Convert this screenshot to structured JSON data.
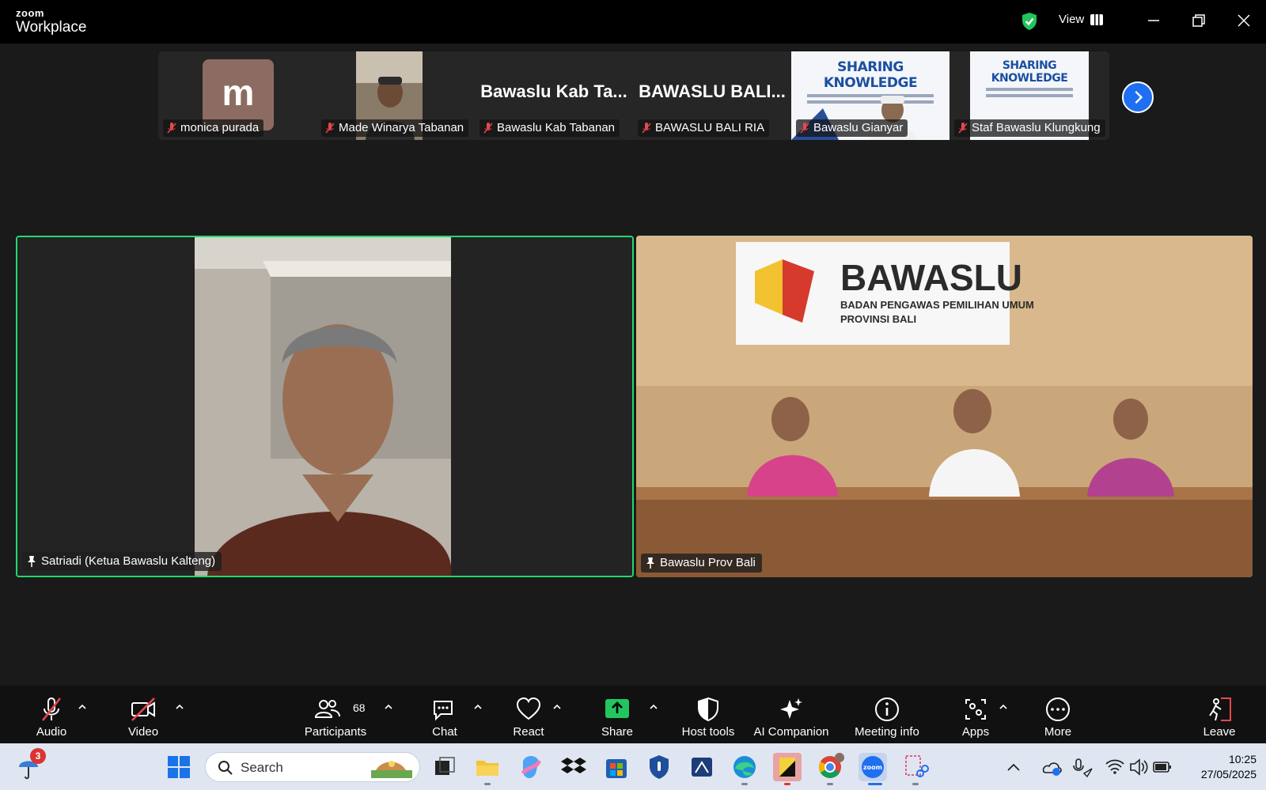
{
  "app": {
    "brand_top": "zoom",
    "brand_bottom": "Workplace",
    "view_label": "View"
  },
  "thumbnails": [
    {
      "name": "monica purada",
      "avatar_letter": "m"
    },
    {
      "name": "Made Winarya Tabanan"
    },
    {
      "name": "Bawaslu Kab Tabanan",
      "big_label": "Bawaslu Kab Ta..."
    },
    {
      "name": "BAWASLU BALI RIA",
      "big_label": "BAWASLU BALI..."
    },
    {
      "name": "Bawaslu Gianyar",
      "slide_title": "SHARING KNOWLEDGE"
    },
    {
      "name": "Staf Bawaslu Klungkung",
      "slide_title": "SHARING KNOWLEDGE"
    }
  ],
  "tiles": {
    "left": {
      "name": "Satriadi (Ketua Bawaslu Kalteng)"
    },
    "right": {
      "name": "Bawaslu Prov Bali",
      "banner_title": "BAWASLU",
      "banner_sub1": "BADAN PENGAWAS PEMILIHAN UMUM",
      "banner_sub2": "PROVINSI BALI"
    }
  },
  "toolbar": {
    "audio": "Audio",
    "video": "Video",
    "participants": "Participants",
    "participants_count": "68",
    "chat": "Chat",
    "react": "React",
    "share": "Share",
    "host_tools": "Host tools",
    "ai_companion": "AI Companion",
    "meeting_info": "Meeting info",
    "apps": "Apps",
    "more": "More",
    "leave": "Leave"
  },
  "taskbar": {
    "search_placeholder": "Search",
    "weather_badge": "3",
    "time": "10:25",
    "date": "27/05/2025"
  },
  "colors": {
    "active_speaker": "#23d96b",
    "accent_blue": "#1f6ff2",
    "leave_red": "#e5484d",
    "share_green": "#22c55e"
  }
}
